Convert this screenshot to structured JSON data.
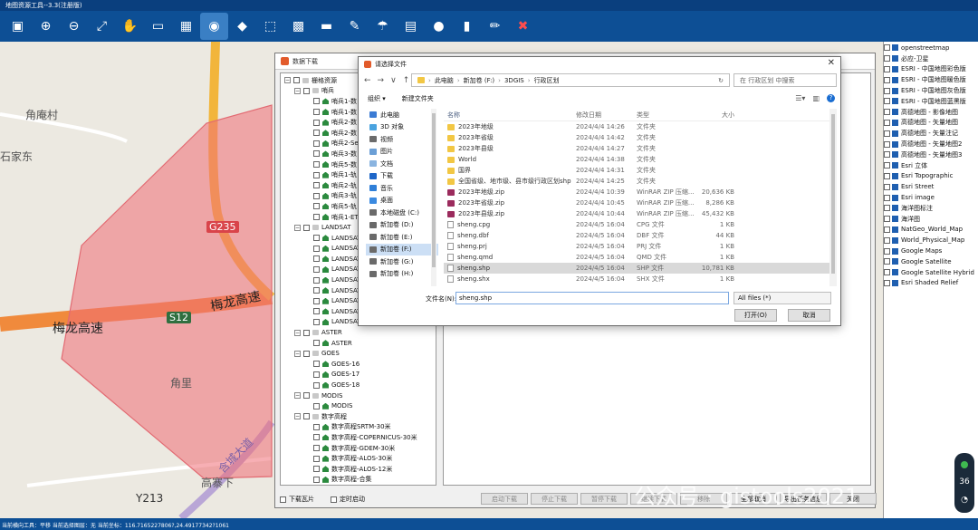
{
  "app": {
    "title": "地图资源工具--3.3(注册版)"
  },
  "toolbar": {
    "buttons": [
      {
        "name": "save-icon",
        "glyph": "▣"
      },
      {
        "name": "zoom-in-icon",
        "glyph": "⊕"
      },
      {
        "name": "zoom-out-icon",
        "glyph": "⊖"
      },
      {
        "name": "full-extent-icon",
        "glyph": "⤢"
      },
      {
        "name": "pan-hand-icon",
        "glyph": "✋"
      },
      {
        "name": "measure-icon",
        "glyph": "▭"
      },
      {
        "name": "grid-icon",
        "glyph": "▦"
      },
      {
        "name": "locate-icon",
        "glyph": "◉"
      },
      {
        "name": "layer-icon",
        "glyph": "◆"
      },
      {
        "name": "select-icon",
        "glyph": "⬚"
      },
      {
        "name": "chess-icon",
        "glyph": "▩"
      },
      {
        "name": "table-icon",
        "glyph": "▬"
      },
      {
        "name": "tool-icon",
        "glyph": "✎"
      },
      {
        "name": "satellite-icon",
        "glyph": "☂"
      },
      {
        "name": "map-icon",
        "glyph": "▤"
      },
      {
        "name": "user-icon",
        "glyph": "●"
      },
      {
        "name": "book-icon",
        "glyph": "▮"
      },
      {
        "name": "pencil-icon",
        "glyph": "✏"
      },
      {
        "name": "close-icon",
        "glyph": "✖"
      }
    ]
  },
  "map": {
    "labels": [
      "角庵村",
      "石家东",
      "梅龙高速",
      "梅龙高速",
      "角里",
      "高寨下",
      "含城大道",
      "Y213"
    ],
    "road_badges": [
      "G235",
      "S12"
    ]
  },
  "layers": [
    "openstreetmap",
    "必应-卫星",
    "ESRI - 中国地图彩色版",
    "ESRI - 中国地图暖色版",
    "ESRI - 中国地图灰色版",
    "ESRI - 中国地图蓝黑版",
    "高德地图 - 影像地图",
    "高德地图 - 矢量地图",
    "高德地图 - 矢量注记",
    "高德地图 - 矢量地图2",
    "高德地图 - 矢量地图3",
    "Esri 立体",
    "Esri Topographic",
    "Esri Street",
    "Esri image",
    "海洋图标注",
    "海洋图",
    "NatGeo_World_Map",
    "World_Physical_Map",
    "Google Maps",
    "Google Satellite",
    "Google Satellite Hybrid",
    "Esri Shaded Relief"
  ],
  "download_dialog": {
    "title": "数据下载",
    "tree": [
      {
        "level": 0,
        "exp": "−",
        "icon": "folder",
        "label": "栅格资源"
      },
      {
        "level": 1,
        "exp": "−",
        "icon": "folder",
        "label": "哨兵"
      },
      {
        "level": 2,
        "icon": "layer",
        "label": "哨兵1-数"
      },
      {
        "level": 2,
        "icon": "layer",
        "label": "哨兵1-数"
      },
      {
        "level": 2,
        "icon": "layer",
        "label": "哨兵2-数"
      },
      {
        "level": 2,
        "icon": "layer",
        "label": "哨兵2-数"
      },
      {
        "level": 2,
        "icon": "layer",
        "label": "哨兵2-Se"
      },
      {
        "level": 2,
        "icon": "layer",
        "label": "哨兵3-数"
      },
      {
        "level": 2,
        "icon": "layer",
        "label": "哨兵5-数"
      },
      {
        "level": 2,
        "icon": "layer",
        "label": "哨兵1-轨"
      },
      {
        "level": 2,
        "icon": "layer",
        "label": "哨兵2-轨"
      },
      {
        "level": 2,
        "icon": "layer",
        "label": "哨兵3-轨"
      },
      {
        "level": 2,
        "icon": "layer",
        "label": "哨兵5-轨"
      },
      {
        "level": 2,
        "icon": "layer",
        "label": "哨兵1-ET"
      },
      {
        "level": 1,
        "exp": "−",
        "icon": "folder",
        "label": "LANDSAT"
      },
      {
        "level": 2,
        "icon": "layer",
        "label": "LANDSAT"
      },
      {
        "level": 2,
        "icon": "layer",
        "label": "LANDSAT"
      },
      {
        "level": 2,
        "icon": "layer",
        "label": "LANDSAT"
      },
      {
        "level": 2,
        "icon": "layer",
        "label": "LANDSAT"
      },
      {
        "level": 2,
        "icon": "layer",
        "label": "LANDSAT"
      },
      {
        "level": 2,
        "icon": "layer",
        "label": "LANDSAT"
      },
      {
        "level": 2,
        "icon": "layer",
        "label": "LANDSAT"
      },
      {
        "level": 2,
        "icon": "layer",
        "label": "LANDSAT"
      },
      {
        "level": 2,
        "icon": "layer",
        "label": "LANDSAT"
      },
      {
        "level": 1,
        "exp": "−",
        "icon": "folder",
        "label": "ASTER"
      },
      {
        "level": 2,
        "icon": "layer",
        "label": "ASTER"
      },
      {
        "level": 1,
        "exp": "−",
        "icon": "folder",
        "label": "GOES"
      },
      {
        "level": 2,
        "icon": "layer",
        "label": "GOES-16"
      },
      {
        "level": 2,
        "icon": "layer",
        "label": "GOES-17"
      },
      {
        "level": 2,
        "icon": "layer",
        "label": "GOES-18"
      },
      {
        "level": 1,
        "exp": "−",
        "icon": "folder",
        "label": "MODIS"
      },
      {
        "level": 2,
        "icon": "layer",
        "label": "MODIS"
      },
      {
        "level": 1,
        "exp": "−",
        "icon": "folder",
        "label": "数字高程"
      },
      {
        "level": 2,
        "icon": "layer",
        "label": "数字高程SRTM-30米"
      },
      {
        "level": 2,
        "icon": "layer",
        "label": "数字高程-COPERNICUS-30米"
      },
      {
        "level": 2,
        "icon": "layer",
        "label": "数字高程-GDEM-30米"
      },
      {
        "level": 2,
        "icon": "layer",
        "label": "数字高程-ALOS-30米"
      },
      {
        "level": 2,
        "icon": "layer",
        "label": "数字高程-ALOS-12米"
      },
      {
        "level": 2,
        "icon": "layer",
        "label": "数字高程-合集"
      }
    ],
    "checkbox_download_tile": "下载瓦片",
    "checkbox_timer": "定时启动",
    "buttons": [
      "启动下载",
      "停止下载",
      "暂停下载",
      "继续下载",
      "移除",
      "全部取消",
      "导出任务信息",
      "关闭"
    ]
  },
  "file_dialog": {
    "title": "请选择文件",
    "nav_arrows": [
      "←",
      "→",
      "∨",
      "↑"
    ],
    "breadcrumb": [
      "此电脑",
      "新加卷 (F:)",
      "3DGIS",
      "行政区划"
    ],
    "search_placeholder": "在 行政区划 中搜索",
    "organize": "组织 ▾",
    "new_folder": "新建文件夹",
    "sidebar": [
      {
        "label": "此电脑",
        "color": "#3b7bd4",
        "selected": false
      },
      {
        "label": "3D 对象",
        "color": "#4aa3df",
        "selected": false
      },
      {
        "label": "视频",
        "color": "#6b6b6b",
        "selected": false
      },
      {
        "label": "图片",
        "color": "#6b9fd6",
        "selected": false
      },
      {
        "label": "文档",
        "color": "#8ab4e0",
        "selected": false
      },
      {
        "label": "下载",
        "color": "#1e66c8",
        "selected": false
      },
      {
        "label": "音乐",
        "color": "#2f7fd8",
        "selected": false
      },
      {
        "label": "桌面",
        "color": "#3b8ae0",
        "selected": false
      },
      {
        "label": "本地磁盘 (C:)",
        "color": "#6a6a6a",
        "selected": false
      },
      {
        "label": "新加卷 (D:)",
        "color": "#6a6a6a",
        "selected": false
      },
      {
        "label": "新加卷 (E:)",
        "color": "#6a6a6a",
        "selected": false
      },
      {
        "label": "新加卷 (F:)",
        "color": "#6a6a6a",
        "selected": true
      },
      {
        "label": "新加卷 (G:)",
        "color": "#6a6a6a",
        "selected": false
      },
      {
        "label": "新加卷 (H:)",
        "color": "#6a6a6a",
        "selected": false
      }
    ],
    "columns": {
      "name": "名称",
      "date": "修改日期",
      "type": "类型",
      "size": "大小"
    },
    "files": [
      {
        "name": "2023年地级",
        "date": "2024/4/4 14:26",
        "type": "文件夹",
        "size": "",
        "icon": "folder"
      },
      {
        "name": "2023年省级",
        "date": "2024/4/4 14:42",
        "type": "文件夹",
        "size": "",
        "icon": "folder"
      },
      {
        "name": "2023年县级",
        "date": "2024/4/4 14:27",
        "type": "文件夹",
        "size": "",
        "icon": "folder"
      },
      {
        "name": "World",
        "date": "2024/4/4 14:38",
        "type": "文件夹",
        "size": "",
        "icon": "folder"
      },
      {
        "name": "国界",
        "date": "2024/4/4 14:31",
        "type": "文件夹",
        "size": "",
        "icon": "folder"
      },
      {
        "name": "全国省级、地市级、县市级行政区划shp",
        "date": "2024/4/4 14:25",
        "type": "文件夹",
        "size": "",
        "icon": "folder"
      },
      {
        "name": "2023年地级.zip",
        "date": "2024/4/4 10:39",
        "type": "WinRAR ZIP 压缩...",
        "size": "20,636 KB",
        "icon": "zip"
      },
      {
        "name": "2023年省级.zip",
        "date": "2024/4/4 10:45",
        "type": "WinRAR ZIP 压缩...",
        "size": "8,286 KB",
        "icon": "zip"
      },
      {
        "name": "2023年县级.zip",
        "date": "2024/4/4 10:44",
        "type": "WinRAR ZIP 压缩...",
        "size": "45,432 KB",
        "icon": "zip"
      },
      {
        "name": "sheng.cpg",
        "date": "2024/4/5 16:04",
        "type": "CPG 文件",
        "size": "1 KB",
        "icon": "file"
      },
      {
        "name": "sheng.dbf",
        "date": "2024/4/5 16:04",
        "type": "DBF 文件",
        "size": "44 KB",
        "icon": "file"
      },
      {
        "name": "sheng.prj",
        "date": "2024/4/5 16:04",
        "type": "PRJ 文件",
        "size": "1 KB",
        "icon": "file"
      },
      {
        "name": "sheng.qmd",
        "date": "2024/4/5 16:04",
        "type": "QMD 文件",
        "size": "1 KB",
        "icon": "file"
      },
      {
        "name": "sheng.shp",
        "date": "2024/4/5 16:04",
        "type": "SHP 文件",
        "size": "10,781 KB",
        "icon": "file",
        "selected": true
      },
      {
        "name": "sheng.shx",
        "date": "2024/4/5 16:04",
        "type": "SHX 文件",
        "size": "1 KB",
        "icon": "file"
      }
    ],
    "filename_label": "文件名(N):",
    "filename_value": "sheng.shp",
    "filter_value": "All files (*)",
    "open_button": "打开(O)",
    "cancel_button": "取消"
  },
  "statusbar": {
    "text": "当前横向工具：平移  当前选择图层：无  当前坐标：116.7165227806?,24.49177342?1061"
  },
  "watermark": "公众号 · gistools2021",
  "widget": {
    "value": "36"
  },
  "colors": {
    "toolbar": "#0d4f95",
    "aoi_fill": "#f08a8f",
    "road": "#f08a3c",
    "map_bg": "#ece9e1"
  }
}
